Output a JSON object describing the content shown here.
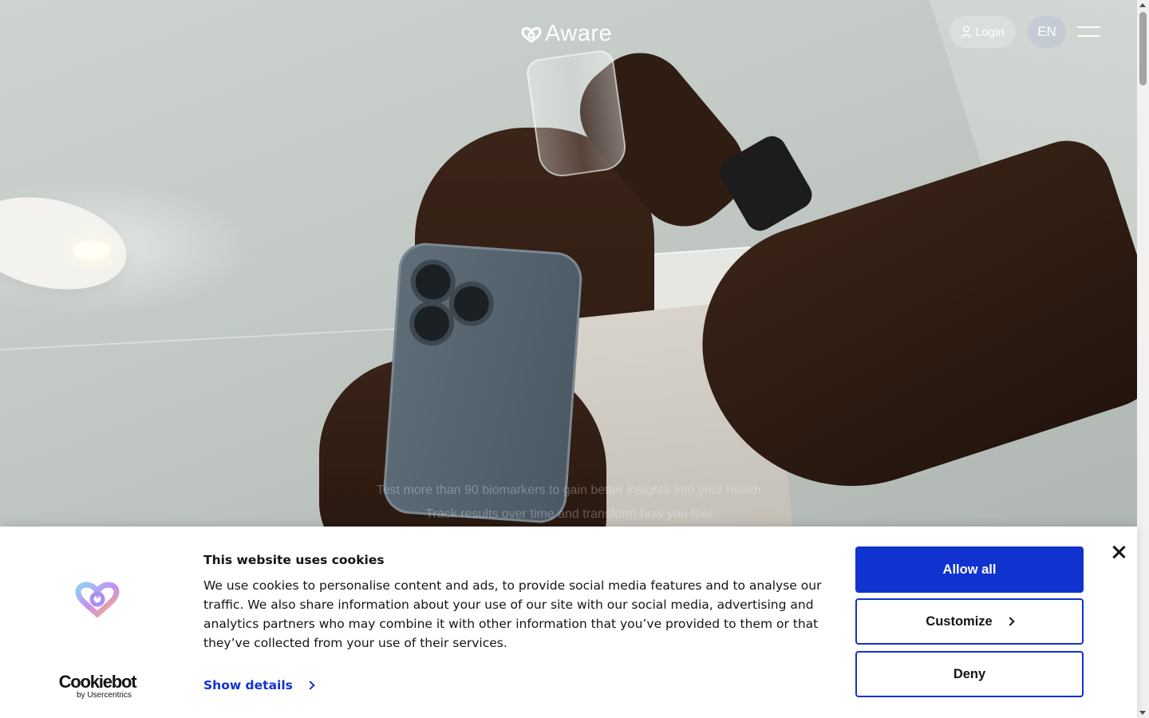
{
  "header": {
    "brand_name": "Aware",
    "login_label": "Login",
    "language": "EN"
  },
  "hero": {
    "tagline": "Test more than 90 biomarkers to gain better insights into your health. Track results over time and transform how you feel."
  },
  "cookie_banner": {
    "title": "This website uses cookies",
    "body": "We use cookies to personalise content and ads, to provide social media features and to analyse our traffic. We also share information about your use of our site with our social media, advertising and analytics partners who may combine it with other information that you’ve provided to them or that they’ve collected from your use of their services.",
    "show_details_label": "Show details",
    "allow_all_label": "Allow all",
    "customize_label": "Customize",
    "deny_label": "Deny",
    "provider_name": "Cookiebot",
    "provider_sub": "by Usercentrics"
  },
  "colors": {
    "accent": "#1032cf",
    "text": "#141414"
  },
  "icons": {
    "login": "user-icon",
    "menu": "hamburger-menu-icon",
    "close": "close-icon",
    "chevron": "chevron-right-icon"
  }
}
